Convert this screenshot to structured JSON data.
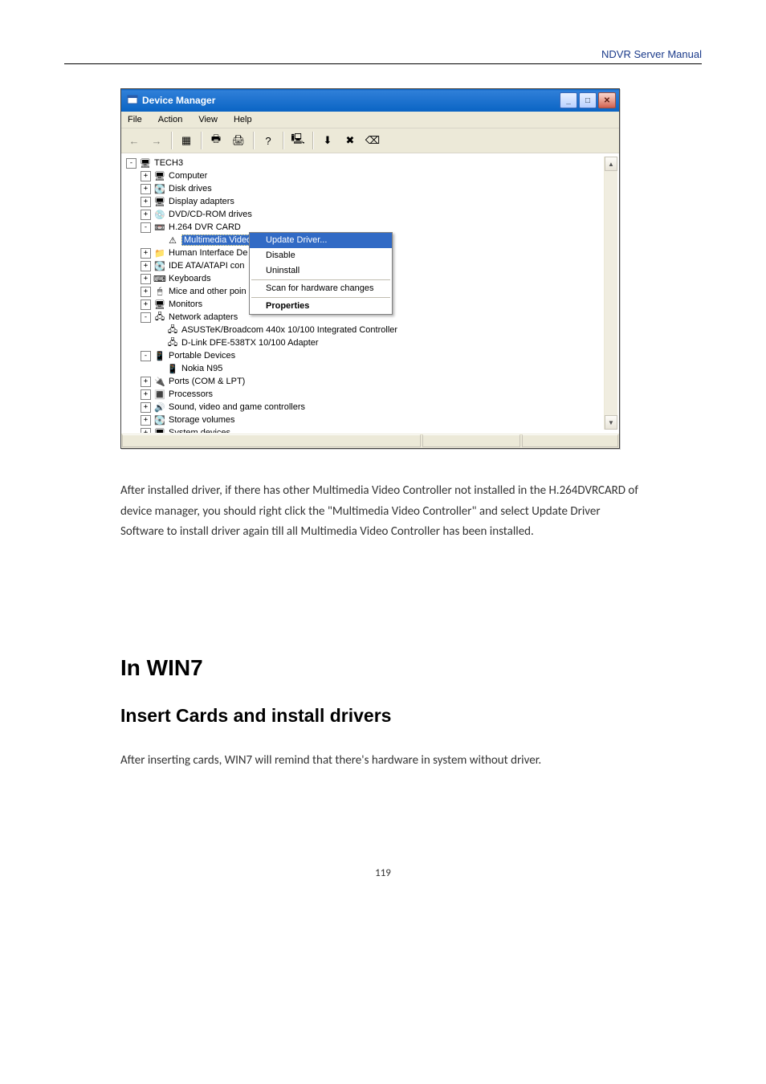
{
  "header_link": "NDVR Server Manual",
  "window": {
    "title": "Device Manager",
    "menus": [
      "File",
      "Action",
      "View",
      "Help"
    ],
    "toolbar_icons": [
      {
        "name": "back-icon",
        "glyph": "←",
        "dim": true
      },
      {
        "name": "forward-icon",
        "glyph": "→",
        "dim": true
      },
      {
        "name": "sep"
      },
      {
        "name": "properties-icon",
        "glyph": "▦",
        "dim": false
      },
      {
        "name": "sep"
      },
      {
        "name": "print-icon",
        "glyph": "🖶",
        "dim": false
      },
      {
        "name": "print2-icon",
        "glyph": "🖨",
        "dim": false
      },
      {
        "name": "sep"
      },
      {
        "name": "help-icon",
        "glyph": "?",
        "dim": false
      },
      {
        "name": "sep"
      },
      {
        "name": "scan-icon",
        "glyph": "🖳",
        "dim": false
      },
      {
        "name": "sep"
      },
      {
        "name": "enable-icon",
        "glyph": "⬇",
        "dim": false
      },
      {
        "name": "disable-icon",
        "glyph": "✖",
        "dim": false
      },
      {
        "name": "uninstall-icon",
        "glyph": "⌫",
        "dim": false
      }
    ],
    "root": "TECH3",
    "nodes": [
      {
        "indent": 1,
        "exp": "+",
        "icon": "🖥",
        "label": "Computer"
      },
      {
        "indent": 1,
        "exp": "+",
        "icon": "💽",
        "label": "Disk drives"
      },
      {
        "indent": 1,
        "exp": "+",
        "icon": "🖥",
        "label": "Display adapters"
      },
      {
        "indent": 1,
        "exp": "+",
        "icon": "💿",
        "label": "DVD/CD-ROM drives"
      },
      {
        "indent": 1,
        "exp": "-",
        "icon": "📼",
        "label": "H.264 DVR CARD"
      },
      {
        "indent": 2,
        "exp": " ",
        "icon": "⚠",
        "label": "Multimedia Video Controller",
        "selected": true
      },
      {
        "indent": 1,
        "exp": "+",
        "icon": "📁",
        "label": "Human Interface De"
      },
      {
        "indent": 1,
        "exp": "+",
        "icon": "💽",
        "label": "IDE ATA/ATAPI con"
      },
      {
        "indent": 1,
        "exp": "+",
        "icon": "⌨",
        "label": "Keyboards"
      },
      {
        "indent": 1,
        "exp": "+",
        "icon": "🖱",
        "label": "Mice and other poin"
      },
      {
        "indent": 1,
        "exp": "+",
        "icon": "🖥",
        "label": "Monitors"
      },
      {
        "indent": 1,
        "exp": "-",
        "icon": "🖧",
        "label": "Network adapters"
      },
      {
        "indent": 2,
        "exp": " ",
        "icon": "🖧",
        "label": "ASUSTeK/Broadcom 440x 10/100 Integrated Controller"
      },
      {
        "indent": 2,
        "exp": " ",
        "icon": "🖧",
        "label": "D-Link DFE-538TX 10/100 Adapter"
      },
      {
        "indent": 1,
        "exp": "-",
        "icon": "📱",
        "label": "Portable Devices"
      },
      {
        "indent": 2,
        "exp": " ",
        "icon": "📱",
        "label": "Nokia N95"
      },
      {
        "indent": 1,
        "exp": "+",
        "icon": "🔌",
        "label": "Ports (COM & LPT)"
      },
      {
        "indent": 1,
        "exp": "+",
        "icon": "🔳",
        "label": "Processors"
      },
      {
        "indent": 1,
        "exp": "+",
        "icon": "🔊",
        "label": "Sound, video and game controllers"
      },
      {
        "indent": 1,
        "exp": "+",
        "icon": "💽",
        "label": "Storage volumes"
      },
      {
        "indent": 1,
        "exp": "+",
        "icon": "🖥",
        "label": "System devices"
      }
    ],
    "context_menu": [
      {
        "label": "Update Driver...",
        "selected": true
      },
      {
        "label": "Disable"
      },
      {
        "label": "Uninstall"
      },
      {
        "div": true
      },
      {
        "label": "Scan for hardware changes"
      },
      {
        "div": true
      },
      {
        "label": "Properties",
        "bold": true
      }
    ]
  },
  "paragraph1": "After installed driver, if there has other Multimedia Video Controller not installed in the H.264DVRCARD of device manager, you should right click the \"Multimedia Video Controller\" and select Update Driver Software to install driver again till all Multimedia Video Controller has been installed.",
  "h1": "In WIN7",
  "h2": "Insert Cards and install drivers",
  "paragraph2": "After inserting cards, WIN7 will remind that there's hardware in system without driver.",
  "pagenum": "119"
}
